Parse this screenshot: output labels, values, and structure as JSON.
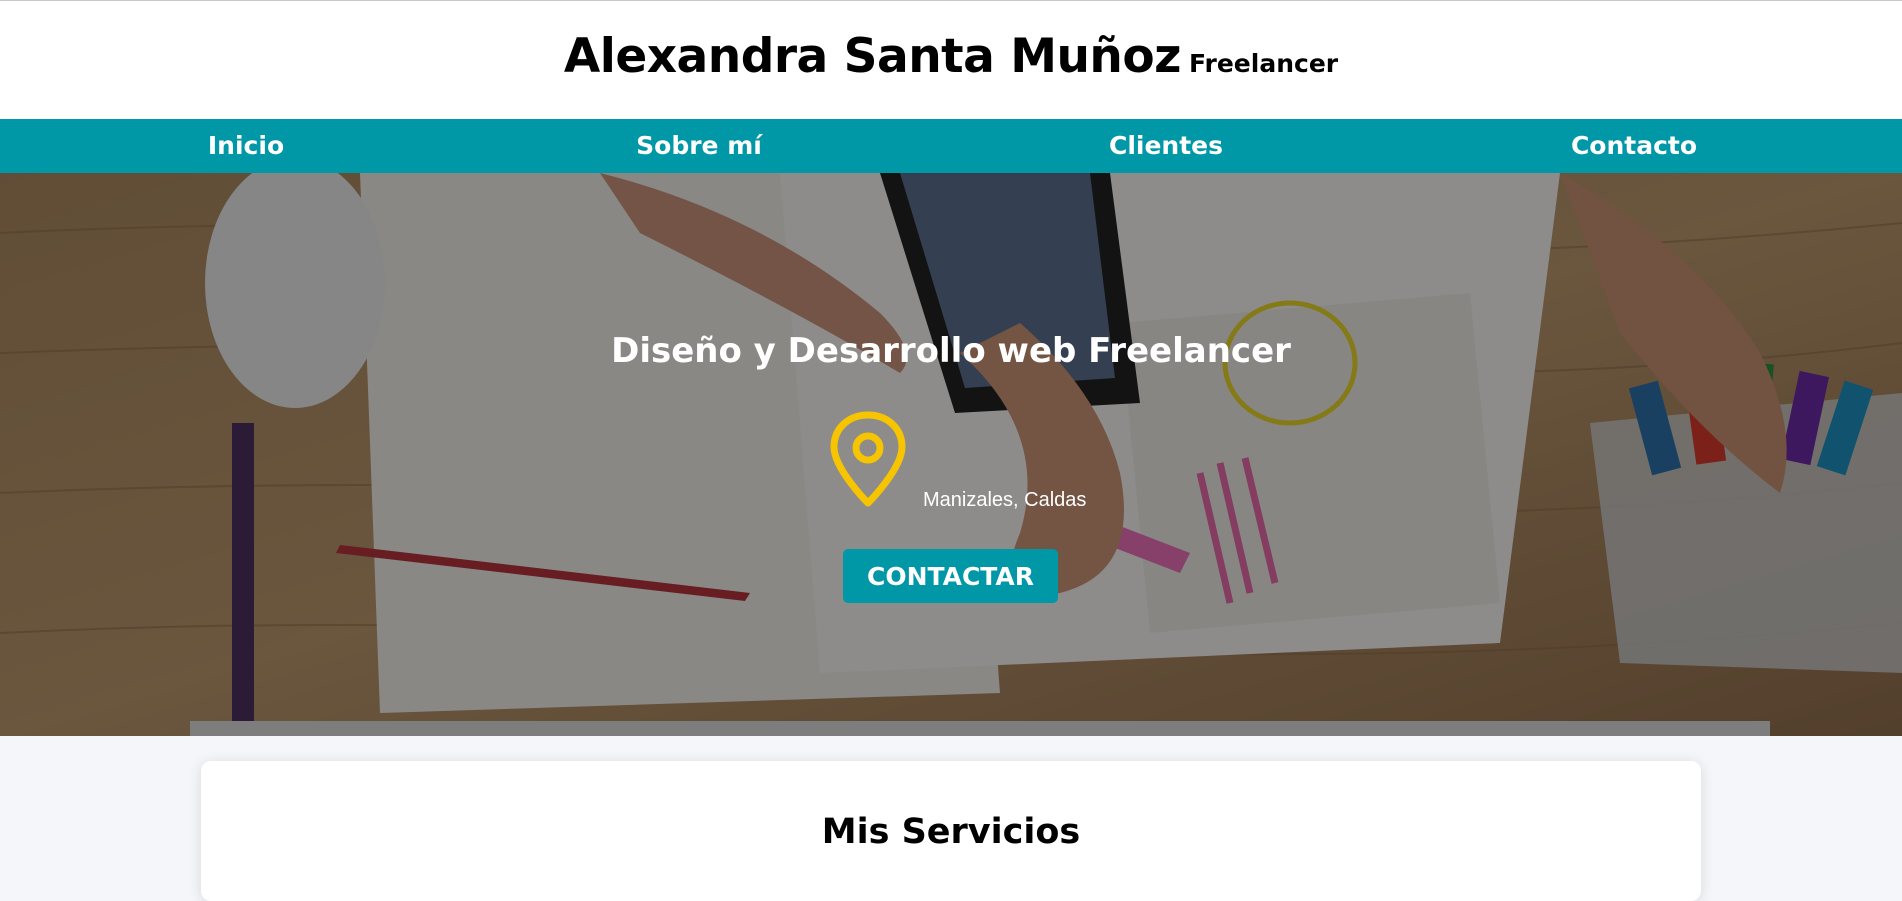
{
  "header": {
    "name": "Alexandra Santa Muñoz",
    "tagline": "Freelancer"
  },
  "nav": {
    "items": [
      {
        "label": "Inicio"
      },
      {
        "label": "Sobre mí"
      },
      {
        "label": "Clientes"
      },
      {
        "label": "Contacto"
      }
    ]
  },
  "hero": {
    "title": "Diseño y Desarrollo web Freelancer",
    "location": "Manizales, Caldas",
    "location_icon": "map-pin-icon",
    "button_label": "CONTACTAR"
  },
  "services": {
    "title": "Mis Servicios"
  },
  "colors": {
    "accent": "#0097a7",
    "pin": "#f6c400",
    "page_bg": "#f4f6f9"
  }
}
